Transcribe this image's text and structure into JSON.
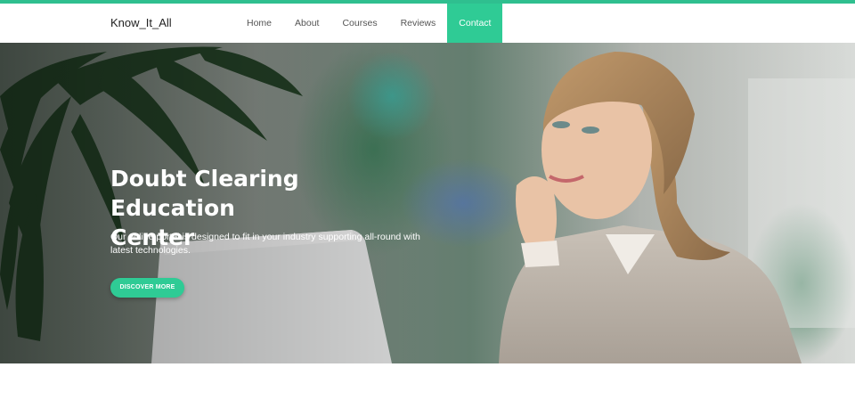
{
  "colors": {
    "accent": "#2fcb95",
    "topbar": "#2fbf8f",
    "nav_background": "#ffffff",
    "hero_text": "#ffffff"
  },
  "header": {
    "brand": "Know_It_All",
    "menu": [
      {
        "label": "Home"
      },
      {
        "label": "About"
      },
      {
        "label": "Courses"
      },
      {
        "label": "Reviews"
      },
      {
        "label": "Contact",
        "active": true
      }
    ]
  },
  "hero": {
    "title_line1": "Doubt Clearing Education",
    "title_line2": "Center",
    "description": "Our online portal is designed to fit in your industry supporting all-round with latest technologies.",
    "cta_label": "DISCOVER MORE"
  }
}
